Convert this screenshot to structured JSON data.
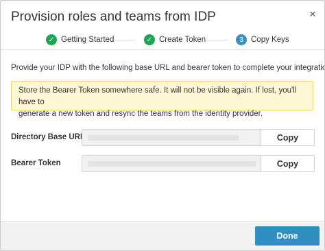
{
  "dialog": {
    "title": "Provision roles and teams from IDP",
    "close_glyph": "×"
  },
  "stepper": {
    "steps": [
      {
        "label": "Getting Started",
        "state": "complete",
        "icon": "check-icon",
        "marker": "✓"
      },
      {
        "label": "Create Token",
        "state": "complete",
        "icon": "check-icon",
        "marker": "✓"
      },
      {
        "label": "Copy Keys",
        "state": "current",
        "marker": "3"
      }
    ]
  },
  "intro_text": "Provide your IDP with the following base URL and bearer token to complete your integration.",
  "warning": {
    "line1": "Store the Bearer Token somewhere safe. It will not be visible again. If lost, you'll have to",
    "line2": "generate a new token and resync the teams from the identity provider."
  },
  "fields": {
    "directory_base_url": {
      "label": "Directory Base URL",
      "value": "",
      "copy_label": "Copy"
    },
    "bearer_token": {
      "label": "Bearer Token",
      "value": "",
      "copy_label": "Copy"
    }
  },
  "footer": {
    "done_label": "Done"
  },
  "colors": {
    "step_complete": "#1fa454",
    "step_current": "#3a8fc0",
    "warning_bg": "#fdf7d6",
    "warning_border": "#ecd36e",
    "primary_button": "#2f8fc3"
  }
}
